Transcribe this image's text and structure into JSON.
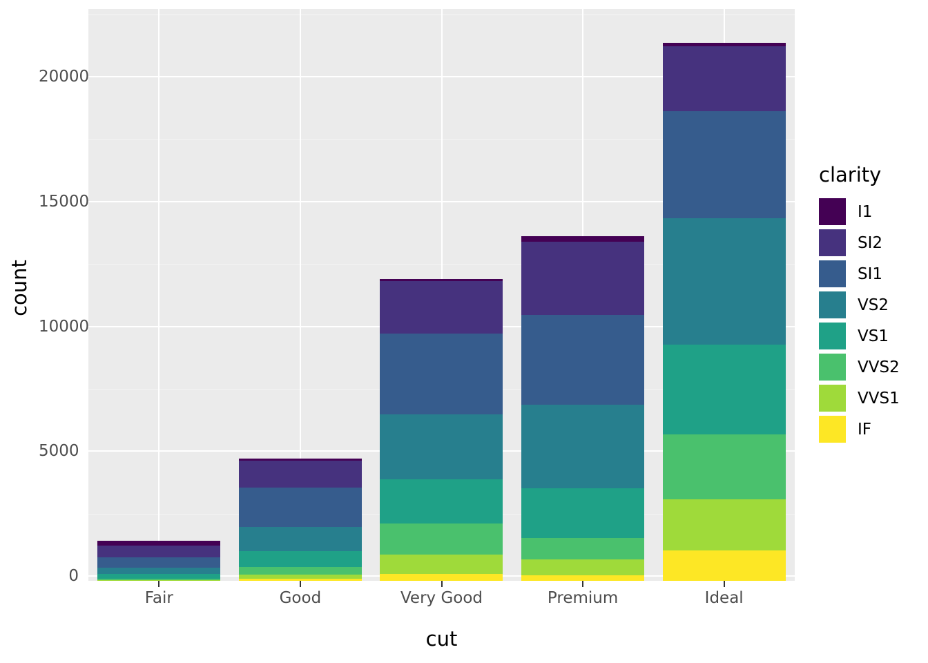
{
  "chart_data": {
    "type": "bar",
    "stacked": true,
    "title": "",
    "xlabel": "cut",
    "ylabel": "count",
    "categories": [
      "Fair",
      "Good",
      "Very Good",
      "Premium",
      "Ideal"
    ],
    "legend_title": "clarity",
    "legend_position": "right",
    "grid": true,
    "ylim": [
      0,
      22000
    ],
    "yticks": [
      0,
      5000,
      10000,
      15000,
      20000
    ],
    "ytick_labels": [
      "0",
      "5000",
      "10000",
      "15000",
      "20000"
    ],
    "series": [
      {
        "name": "I1",
        "color": "#440154",
        "values": [
          210,
          96,
          84,
          205,
          146
        ]
      },
      {
        "name": "SI2",
        "color": "#46327E",
        "values": [
          466,
          1081,
          2100,
          2949,
          2598
        ]
      },
      {
        "name": "SI1",
        "color": "#365C8D",
        "values": [
          408,
          1560,
          3240,
          3575,
          4282
        ]
      },
      {
        "name": "VS2",
        "color": "#277F8E",
        "values": [
          261,
          978,
          2591,
          3357,
          5071
        ]
      },
      {
        "name": "VS1",
        "color": "#1FA187",
        "values": [
          170,
          648,
          1775,
          1989,
          3589
        ]
      },
      {
        "name": "VVS2",
        "color": "#4AC16D",
        "values": [
          69,
          286,
          1235,
          870,
          2606
        ]
      },
      {
        "name": "VVS1",
        "color": "#9FDA3A",
        "values": [
          17,
          186,
          789,
          616,
          2047
        ]
      },
      {
        "name": "IF",
        "color": "#FDE725",
        "values": [
          9,
          71,
          268,
          230,
          1212
        ]
      }
    ],
    "totals": [
      1610,
      4906,
      12082,
      13791,
      21551
    ]
  },
  "panel": {
    "background_color": "#EBEBEB",
    "gridline_color": "#FFFFFF"
  },
  "axes": {
    "tick_label_color": "#4D4D4D",
    "axis_title_color": "#000000"
  }
}
